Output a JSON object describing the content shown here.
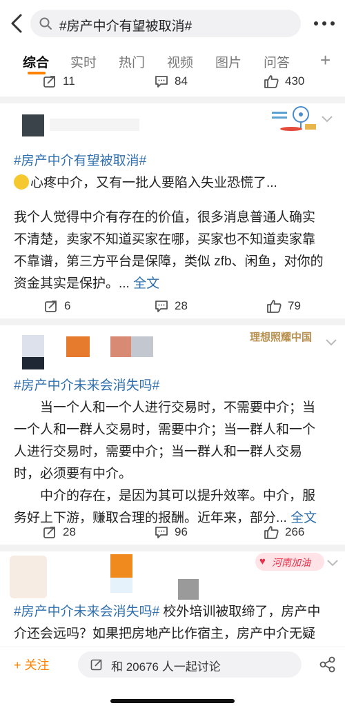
{
  "search": {
    "query": "#房产中介有望被取消#"
  },
  "tabs": [
    "综合",
    "实时",
    "热门",
    "视频",
    "图片",
    "问答"
  ],
  "colors": {
    "accent": "#ff8200",
    "link": "#2f6fae"
  },
  "prev_post": {
    "reposts": "11",
    "comments": "84",
    "likes": "430"
  },
  "post1": {
    "tag": "#房产中介有望被取消#",
    "line1": "心疼中介，又有一批人要陷入失业恐慌了...",
    "body": [
      "我个人觉得中介有存在的价值，很多消息普通人确实",
      "不清楚，卖家不知道买家在哪，买家也不知道卖家靠",
      "不靠谱，第三方平台是保障，类似 zfb、闲鱼，对你的",
      "资金其实是保护。..."
    ],
    "more_link": "全文",
    "reposts": "6",
    "comments": "28",
    "likes": "79"
  },
  "post2": {
    "watermark": "理想照耀中国",
    "tag": "#房产中介未来会消失吗#",
    "lines": [
      "当一个人和一个人进行交易时，不需要中介；当",
      "一个人和一群人交易时，需要中介；当一群人和一个",
      "人进行交易时，需要中介；当一群人和一群人交易",
      "时，必须要有中介。",
      "中介的存在，是因为其可以提升效率。中介，服",
      "务好上下游，赚取合理的报酬。近年来，部分..."
    ],
    "more_link": "全文",
    "reposts": "28",
    "comments": "96",
    "likes": "266"
  },
  "post3": {
    "badge": "河南加油",
    "tag": "#房产中介未来会消失吗#",
    "line1_rest": "校外培训被取缔了，房产中",
    "line2": "介还会远吗？如果把房地产比作宿主，房产中介无疑"
  },
  "bottom": {
    "follow": "+ 关注",
    "discuss": "和 20676 人一起讨论"
  }
}
